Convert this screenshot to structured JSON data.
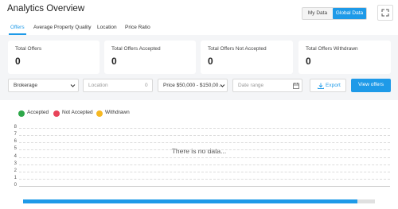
{
  "header": {
    "title": "Analytics Overview",
    "toggle": [
      "My Data",
      "Global Data"
    ],
    "active_toggle": "Global Data"
  },
  "tabs": [
    "Offers",
    "Average Property Quality",
    "Location",
    "Price Ratio"
  ],
  "active_tab": "Offers",
  "cards": [
    {
      "label": "Total Offers",
      "value": "0"
    },
    {
      "label": "Total Offers Accepted",
      "value": "0"
    },
    {
      "label": "Total Offers Not Accepted",
      "value": "0"
    },
    {
      "label": "Total Offers Withdrawn",
      "value": "0"
    }
  ],
  "filters": {
    "brokerage": "Brokerage",
    "location": "Location",
    "location_count": "0",
    "price": "Price $50,000 - $150,00...",
    "date_range": "Date range",
    "export_label": "Export",
    "view_label": "View offers"
  },
  "chart_data": {
    "type": "line",
    "series": [
      {
        "name": "Accepted",
        "color": "#2ea84a",
        "values": []
      },
      {
        "name": "Not Accepted",
        "color": "#e8445a",
        "values": []
      },
      {
        "name": "Withdrawn",
        "color": "#f6b822",
        "values": []
      }
    ],
    "yticks": [
      "0",
      "1",
      "2",
      "3",
      "4",
      "5",
      "6",
      "7",
      "8"
    ],
    "ylim": [
      0,
      8
    ],
    "empty_message": "There is no data...",
    "legend_position": "top-left",
    "grid": true
  },
  "scroll_progress": 0.95,
  "colors": {
    "accent": "#1e9ae8"
  },
  "icons": {
    "expand": "expand-icon",
    "chevron": "chevron-down-icon",
    "calendar": "calendar-icon",
    "download": "download-icon"
  }
}
